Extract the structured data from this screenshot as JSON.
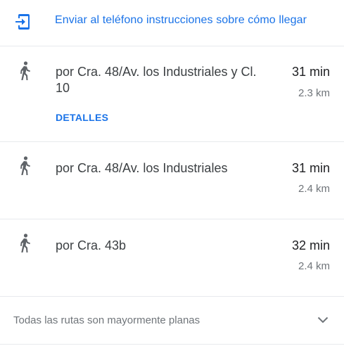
{
  "send_to_phone": {
    "label": "Enviar al teléfono instrucciones sobre cómo llegar",
    "icon": "send-to-phone-icon"
  },
  "routes": [
    {
      "icon": "walking-person-icon",
      "description": "por Cra. 48/Av. los Industriales y Cl. 10",
      "time": "31 min",
      "distance": "2.3 km",
      "details_label": "DETALLES"
    },
    {
      "icon": "walking-person-icon",
      "description": "por Cra. 48/Av. los Industriales",
      "time": "31 min",
      "distance": "2.4 km"
    },
    {
      "icon": "walking-person-icon",
      "description": "por Cra. 43b",
      "time": "32 min",
      "distance": "2.4 km"
    }
  ],
  "footer": {
    "text": "Todas las rutas son mayormente planas",
    "icon": "chevron-down-icon"
  },
  "colors": {
    "accent": "#1a73e8",
    "icon_gray": "#5f6368",
    "secondary_text": "#70757a",
    "divider": "#e8eaed"
  }
}
